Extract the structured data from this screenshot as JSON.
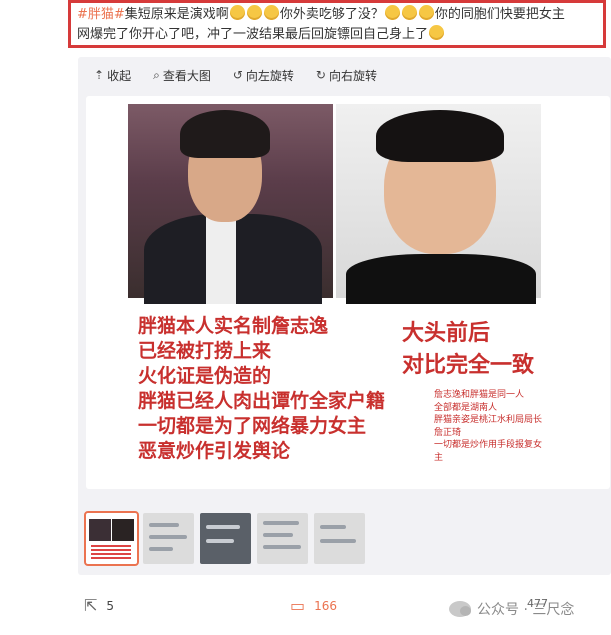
{
  "post": {
    "hashtag": "#胖猫#",
    "text_1": "集短原来是演戏啊",
    "text_2": "你外卖吃够了没？",
    "text_3": "你的同胞们快要把女主",
    "text_4": "网爆完了你开心了吧，冲了一波结果最后回旋镖回自己身上了",
    "emoji_names": [
      "sweat-smile-emoji",
      "sweat-smile-emoji",
      "sweat-smile-emoji",
      "laugh-cry-emoji",
      "laugh-cry-emoji",
      "laugh-cry-emoji",
      "party-emoji"
    ]
  },
  "toolbar": {
    "collapse": "收起",
    "view_large": "查看大图",
    "rotate_left": "向左旋转",
    "rotate_right": "向右旋转"
  },
  "image": {
    "caption_left": "胖猫本人实名制詹志逸\n已经被打捞上来\n火化证是伪造的\n胖猫已经人肉出谭竹全家户籍\n一切都是为了网络暴力女主\n恶意炒作引发舆论",
    "caption_right_big": "大头前后\n对比完全一致",
    "caption_right_small": "詹志逸和胖猫是同一人\n全部都是湖南人\n胖猫亲姿是桃江水利局局长\n詹正琦\n一切都是炒作用手段报复女\n主"
  },
  "thumbnails": [
    {
      "type": "photo",
      "active": true
    },
    {
      "type": "screen",
      "active": false
    },
    {
      "type": "screen",
      "active": false
    },
    {
      "type": "screen",
      "active": false
    },
    {
      "type": "screen",
      "active": false
    }
  ],
  "footer": {
    "share_count": "5",
    "comment_count": "166",
    "like_count": "477",
    "watermark": "公众号 · 三尺念"
  },
  "colors": {
    "highlight_border": "#d63a3a",
    "accent": "#eb7350",
    "caption_red": "#c8302e"
  }
}
